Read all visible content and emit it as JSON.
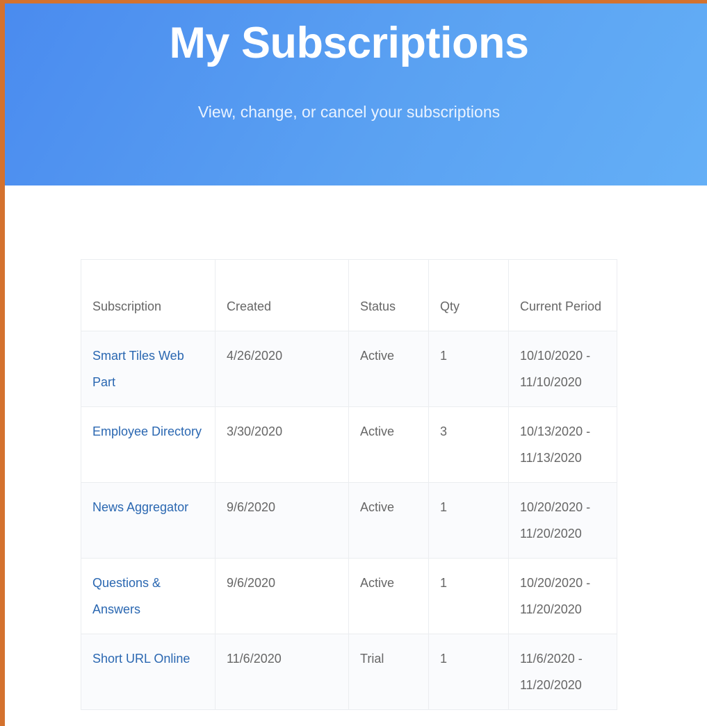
{
  "hero": {
    "title": "My Subscriptions",
    "subtitle": "View, change, or cancel your subscriptions"
  },
  "colors": {
    "frame_border": "#d4722e",
    "hero_gradient_start": "#4a8bef",
    "hero_gradient_end": "#64aff6",
    "link": "#2a67b1"
  },
  "table": {
    "headers": {
      "subscription": "Subscription",
      "created": "Created",
      "status": "Status",
      "qty": "Qty",
      "current_period": "Current Period"
    },
    "rows": [
      {
        "subscription": "Smart Tiles Web Part",
        "created": "4/26/2020",
        "status": "Active",
        "qty": "1",
        "period": "10/10/2020 - 11/10/2020"
      },
      {
        "subscription": "Employee Directory",
        "created": "3/30/2020",
        "status": "Active",
        "qty": "3",
        "period": "10/13/2020 - 11/13/2020"
      },
      {
        "subscription": "News Aggregator",
        "created": "9/6/2020",
        "status": "Active",
        "qty": "1",
        "period": "10/20/2020 - 11/20/2020"
      },
      {
        "subscription": "Questions & Answers",
        "created": "9/6/2020",
        "status": "Active",
        "qty": "1",
        "period": "10/20/2020 - 11/20/2020"
      },
      {
        "subscription": "Short URL Online",
        "created": "11/6/2020",
        "status": "Trial",
        "qty": "1",
        "period": "11/6/2020 - 11/20/2020"
      }
    ]
  }
}
